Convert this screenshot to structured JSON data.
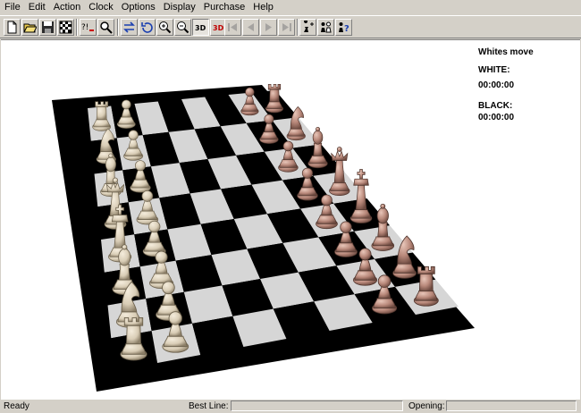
{
  "menu": [
    "File",
    "Edit",
    "Action",
    "Clock",
    "Options",
    "Display",
    "Purchase",
    "Help"
  ],
  "toolbar": {
    "buttons": [
      {
        "name": "new-game-button",
        "icon": "new-document-icon"
      },
      {
        "name": "open-button",
        "icon": "folder-open-icon"
      },
      {
        "name": "save-button",
        "icon": "floppy-disk-icon"
      },
      {
        "name": "board-setup-button",
        "icon": "checkerboard-icon"
      },
      {
        "name": "hint-button",
        "icon": "hint-icon"
      },
      {
        "name": "search-button",
        "icon": "magnifier-search-icon"
      },
      {
        "name": "flip-board-button",
        "icon": "flip-board-icon"
      },
      {
        "name": "rotate-board-button",
        "icon": "rotate-board-icon"
      },
      {
        "name": "zoom-in-button",
        "icon": "zoom-in-icon"
      },
      {
        "name": "zoom-out-button",
        "icon": "zoom-out-icon"
      },
      {
        "name": "view-3d-button",
        "icon": "3d-view-icon"
      },
      {
        "name": "view-3d-red-button",
        "icon": "3d-red-icon"
      },
      {
        "name": "first-move-button",
        "icon": "first-icon"
      },
      {
        "name": "back-move-button",
        "icon": "back-icon"
      },
      {
        "name": "forward-move-button",
        "icon": "forward-icon"
      },
      {
        "name": "last-move-button",
        "icon": "last-icon"
      },
      {
        "name": "add-piece-button",
        "icon": "add-piece-icon"
      },
      {
        "name": "piece-set-button",
        "icon": "pieces-icon"
      },
      {
        "name": "help-button",
        "icon": "question-mark-icon"
      }
    ],
    "labels": {
      "3d": "3D"
    }
  },
  "game": {
    "status": "Whites move",
    "white_label": "WHITE:",
    "white_clock": "00:00:00",
    "black_label": "BLACK:",
    "black_clock": "00:00:00"
  },
  "colors": {
    "white_piece": "#d9cdb6",
    "black_piece": "#b9897b",
    "dark_square": "#000000",
    "light_square": "#d6d6d6"
  },
  "statusbar": {
    "ready": "Ready",
    "best_line_label": "Best Line:",
    "opening_label": "Opening:"
  }
}
